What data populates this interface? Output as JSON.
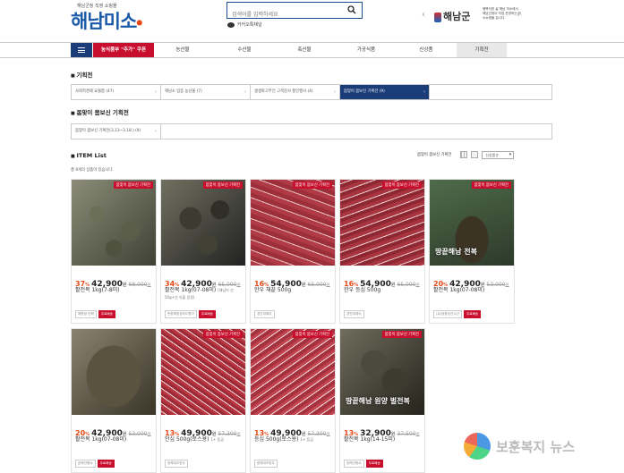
{
  "header": {
    "logo_tagline": "해남군청 직영 쇼핑몰",
    "logo_text": "해남미소",
    "search_placeholder": "검색어를 입력하세요",
    "kakao_label": "카카오톡채널",
    "banner_logo": "해남군",
    "banner_text": "행복더한 삶 해남 미소에서 해남군청이 직접 운영하는 미소쇼핑몰 입니다."
  },
  "nav": {
    "promo": "농식품부 \"추가\" 쿠폰",
    "items": [
      "농산물",
      "수산물",
      "축산물",
      "가공식품",
      "신상품",
      "기획전"
    ]
  },
  "section1": {
    "title": "기획전",
    "filters": [
      "사회적경제 요볼쯤 (47)",
      "해남소 입증 농산물 (7)",
      "생생화고부전 고객감사 할인행사 (4)",
      "봄맞이 몸보신 기획전 (9)"
    ]
  },
  "section2": {
    "title": "봄맞이 몸보신 기획전",
    "filters": [
      "봄맞이 몸보신 기획전(3.13~3.18.) (9)"
    ]
  },
  "item_list": {
    "title": "ITEM List",
    "count_text": "총 9개의 상품이 있습니다.",
    "sort_label": "봄맞이 몸보신 기획전",
    "sort_select": "신상품순"
  },
  "products": [
    {
      "badge": "봄맞이 몸보신 기획전",
      "disc": "37",
      "price": "42,900",
      "orig": "68,000",
      "name": "활전복 1kg(7-8미)",
      "sub": "",
      "tags": [
        "해원쌍 언해",
        "무료배송"
      ],
      "img_text": ""
    },
    {
      "badge": "봄맞이 몸보신 기획전",
      "disc": "34",
      "price": "42,900",
      "orig": "65,000",
      "name": "활전복 1kg(07-08미)",
      "sub": "(해남어 선 50g+선 유출 증정)",
      "tags": [
        "반환해정성하드원아",
        "무료배송"
      ],
      "img_text": ""
    },
    {
      "badge": "봄맞이 몸보신 기획전",
      "disc": "16",
      "price": "54,900",
      "orig": "65,000",
      "name": "한우 채끝 500g",
      "sub": "",
      "tags": [
        "경진대예이"
      ],
      "img_text": ""
    },
    {
      "badge": "봄맞이 몸보신 기획전",
      "disc": "16",
      "price": "54,900",
      "orig": "65,000",
      "name": "한우 등심 500g",
      "sub": "",
      "tags": [
        "경진대예이"
      ],
      "img_text": ""
    },
    {
      "badge": "봄맞이 몸보신 기획전",
      "disc": "20",
      "price": "42,900",
      "orig": "53,000",
      "name": "활전복 1kg(07-08미)",
      "sub": "",
      "tags": [
        "(큐)쌍환당선수산",
        "무료배송"
      ],
      "img_text": "땅끝해남 전복"
    },
    {
      "badge": "",
      "disc": "20",
      "price": "42,900",
      "orig": "53,000",
      "name": "활전복 1kg(07-08미)",
      "sub": "",
      "tags": [
        "완해언행씨",
        "무료배송"
      ],
      "img_text": ""
    },
    {
      "badge": "봄맞이 몸보신 기획전",
      "disc": "13",
      "price": "49,900",
      "orig": "57,300",
      "name": "안심 500g(로스용)",
      "sub": "1+ 등급",
      "tags": [
        "현해대조한우"
      ],
      "img_text": ""
    },
    {
      "badge": "봄맞이 몸보신 기획전",
      "disc": "13",
      "price": "49,900",
      "orig": "57,300",
      "name": "등심 500g(로스용)",
      "sub": "1+ 등급",
      "tags": [
        "현해대조한우"
      ],
      "img_text": ""
    },
    {
      "badge": "봄맞이 몸보신 기획전",
      "disc": "13",
      "price": "32,900",
      "orig": "37,500",
      "name": "활전복 1kg(14-15미)",
      "sub": "",
      "tags": [
        "완해언행씨",
        "무료배송"
      ],
      "img_text": "땅끝해남 원양 벌전복"
    }
  ],
  "watermark": {
    "text": "보훈복지 뉴스"
  },
  "colors": {
    "brand_navy": "#1a3d7a",
    "accent_red": "#c8102e",
    "discount": "#e64a19"
  }
}
